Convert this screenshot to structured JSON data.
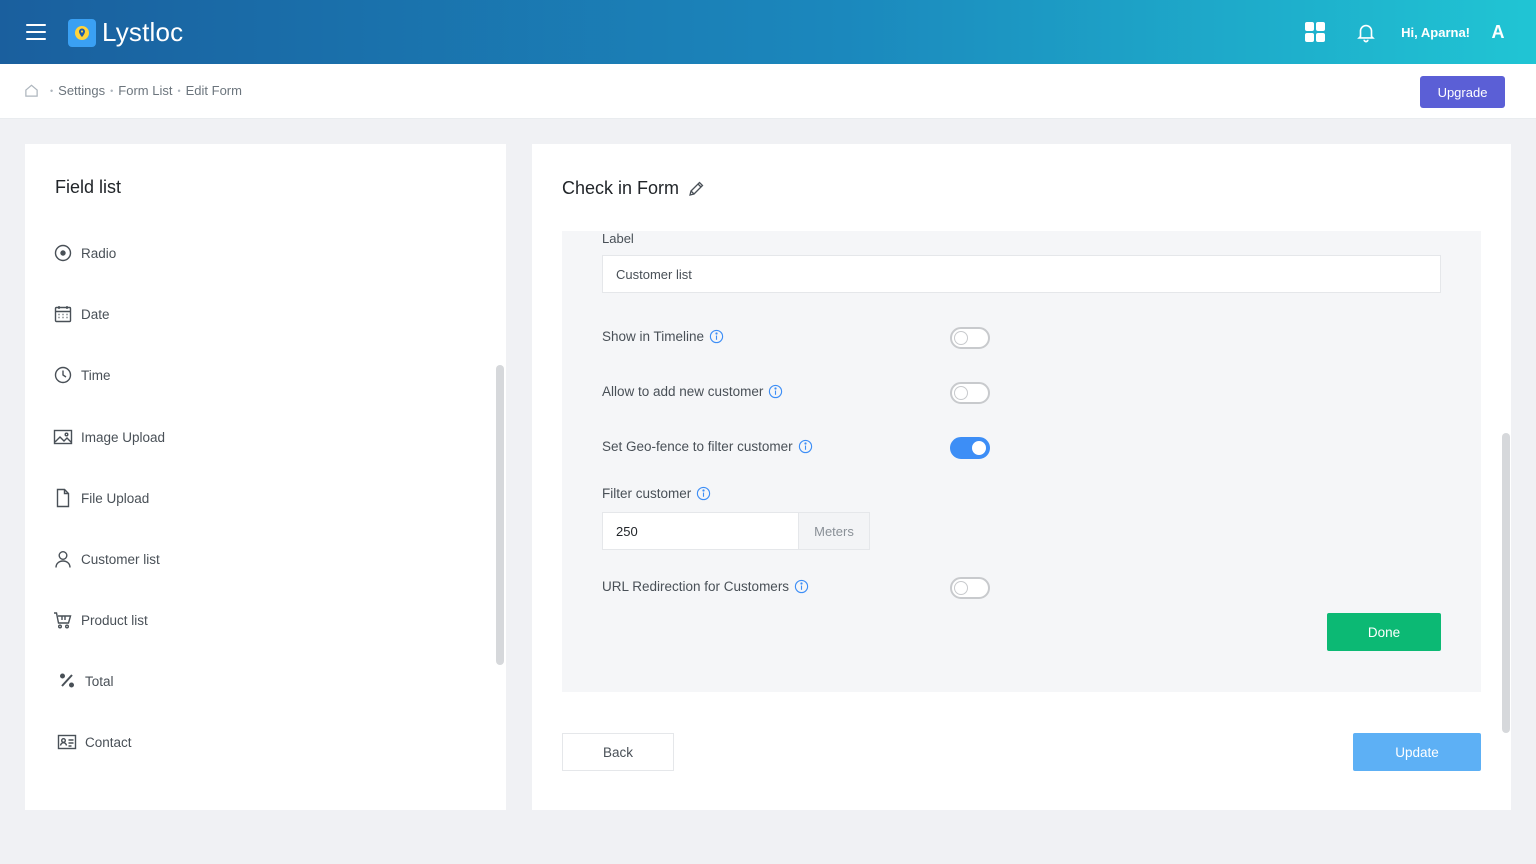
{
  "app": {
    "name": "Lystloc",
    "greeting": "Hi, Aparna!",
    "avatar_initial": "A"
  },
  "breadcrumb": {
    "items": [
      "Settings",
      "Form List",
      "Edit Form"
    ]
  },
  "header": {
    "upgrade_label": "Upgrade"
  },
  "field_list": {
    "title": "Field list",
    "items": [
      {
        "label": "Radio",
        "icon": "radio-icon"
      },
      {
        "label": "Date",
        "icon": "calendar-icon"
      },
      {
        "label": "Time",
        "icon": "clock-icon"
      },
      {
        "label": "Image Upload",
        "icon": "image-icon"
      },
      {
        "label": "File Upload",
        "icon": "file-icon"
      },
      {
        "label": "Customer list",
        "icon": "user-icon"
      },
      {
        "label": "Product list",
        "icon": "cart-icon"
      },
      {
        "label": "Total",
        "icon": "percent-icon"
      },
      {
        "label": "Contact",
        "icon": "contact-card-icon"
      }
    ]
  },
  "form": {
    "title": "Check in Form",
    "label_caption": "Label",
    "label_value": "Customer list",
    "options": {
      "show_timeline": {
        "label": "Show in Timeline",
        "on": false
      },
      "allow_new_customer": {
        "label": "Allow to add new customer",
        "on": false
      },
      "geo_fence": {
        "label": "Set Geo-fence to filter customer",
        "on": true
      },
      "url_redirection": {
        "label": "URL Redirection for Customers",
        "on": false
      }
    },
    "filter_customer": {
      "label": "Filter customer",
      "value": "250",
      "unit": "Meters"
    },
    "done_label": "Done",
    "back_label": "Back",
    "update_label": "Update"
  },
  "colors": {
    "accent": "#5b5fd6",
    "done": "#0cb974",
    "update": "#5db0f5",
    "toggle_on": "#3d8ef6"
  }
}
